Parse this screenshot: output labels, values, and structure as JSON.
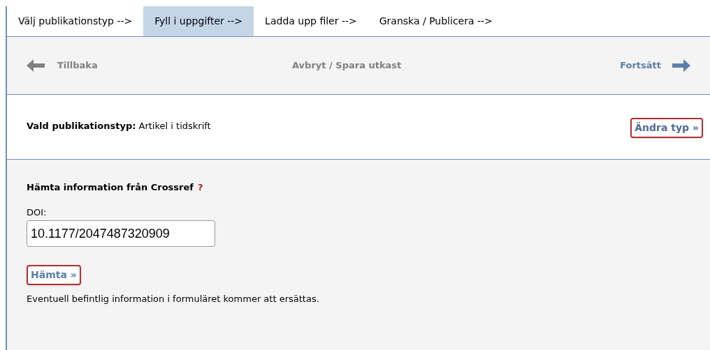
{
  "steps": [
    {
      "label": "Välj publikationstyp -->",
      "selected": false
    },
    {
      "label": "Fyll i uppgifter -->",
      "selected": true
    },
    {
      "label": "Ladda upp filer -->",
      "selected": false
    },
    {
      "label": "Granska / Publicera -->",
      "selected": false
    }
  ],
  "nav": {
    "back": "Tillbaka",
    "cancel": "Avbryt / Spara utkast",
    "next": "Fortsätt"
  },
  "type_section": {
    "label": "Vald publikationstyp:",
    "value": "Artikel i tidskrift",
    "button": "Ändra typ »"
  },
  "crossref": {
    "heading": "Hämta information från Crossref",
    "help": "?",
    "field_label": "DOI:",
    "value": "10.1177/2047487320909",
    "button": "Hämta »",
    "note": "Eventuell befintlig information i formuläret kommer att ersättas."
  }
}
